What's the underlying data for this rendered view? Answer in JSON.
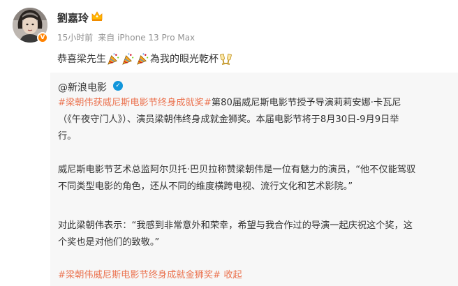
{
  "user": {
    "name": "劉嘉玲",
    "crown_icon": "crown-icon",
    "avatar_badge_color": "#ff8200"
  },
  "meta": {
    "time": "15小时前",
    "source": "来自 iPhone 13 Pro Max"
  },
  "post": {
    "text_before": "恭喜梁先生",
    "text_after": "為我的眼光乾杯",
    "emojis": [
      "party-popper-icon",
      "party-popper-icon",
      "party-popper-icon",
      "clinking-glasses-icon"
    ]
  },
  "repost": {
    "author": "@新浪电影",
    "verified_color": "#1296db",
    "para1": {
      "hashtag": "#梁朝伟获威尼斯电影节终身成就奖#",
      "line1_rest": "第80届威尼斯电影节授予导演莉莉安娜·卡瓦尼",
      "line2": "（《午夜守门人》）、演员梁朝伟终身成就金狮奖。本届电影节将于8月30日-9月9日举",
      "line3": "行。"
    },
    "para2": {
      "line1": "威尼斯电影节艺术总监阿尔贝托·巴贝拉称赞梁朝伟是一位有魅力的演员，“他不仅能驾驭",
      "line2": "不同类型电影的角色，还从不同的维度横跨电视、流行文化和艺术影院。”"
    },
    "para3": {
      "line1": "对此梁朝伟表示：“我感到非常意外和荣幸，希望与我合作过的导演一起庆祝这个奖，这",
      "line2": "个奖也是对他们的致敬。”"
    },
    "footer": {
      "hashtag": "#梁朝伟威尼斯电影节终身成就金狮奖#",
      "collapse": "收起"
    }
  },
  "colors": {
    "hashtag": "#eb7350",
    "meta": "#939393",
    "repost_bg": "#f7f7f7"
  }
}
